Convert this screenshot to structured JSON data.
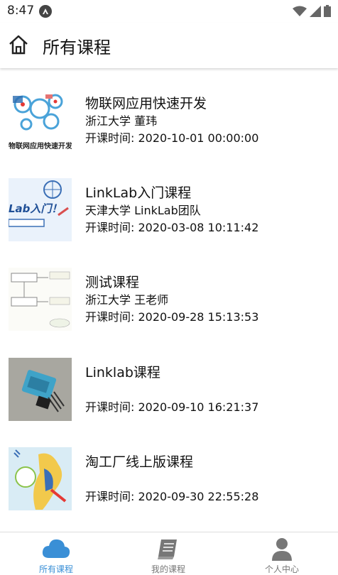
{
  "status_bar": {
    "time": "8:47"
  },
  "header": {
    "title": "所有课程"
  },
  "courses": [
    {
      "name": "物联网应用快速开发",
      "teacher": "浙江大学 董玮",
      "start_time": "开课时间: 2020-10-01 00:00:00",
      "thumb_caption": "物联网应用快速开发"
    },
    {
      "name": "LinkLab入门课程",
      "teacher": "天津大学 LinkLab团队",
      "start_time": "开课时间: 2020-03-08 10:11:42",
      "thumb_caption": "Lab入门！"
    },
    {
      "name": "测试课程",
      "teacher": "浙江大学 王老师",
      "start_time": "开课时间: 2020-09-28 15:13:53"
    },
    {
      "name": "Linklab课程",
      "teacher": "",
      "start_time": "开课时间: 2020-09-10 16:21:37"
    },
    {
      "name": "淘工厂线上版课程",
      "teacher": "",
      "start_time": "开课时间: 2020-09-30 22:55:28"
    }
  ],
  "bottom_nav": {
    "items": [
      {
        "label": "所有课程",
        "icon": "cloud-icon",
        "active": true
      },
      {
        "label": "我的课程",
        "icon": "book-icon",
        "active": false
      },
      {
        "label": "个人中心",
        "icon": "person-icon",
        "active": false
      }
    ],
    "active_color": "#3a8fd6",
    "inactive_color": "#777777"
  }
}
